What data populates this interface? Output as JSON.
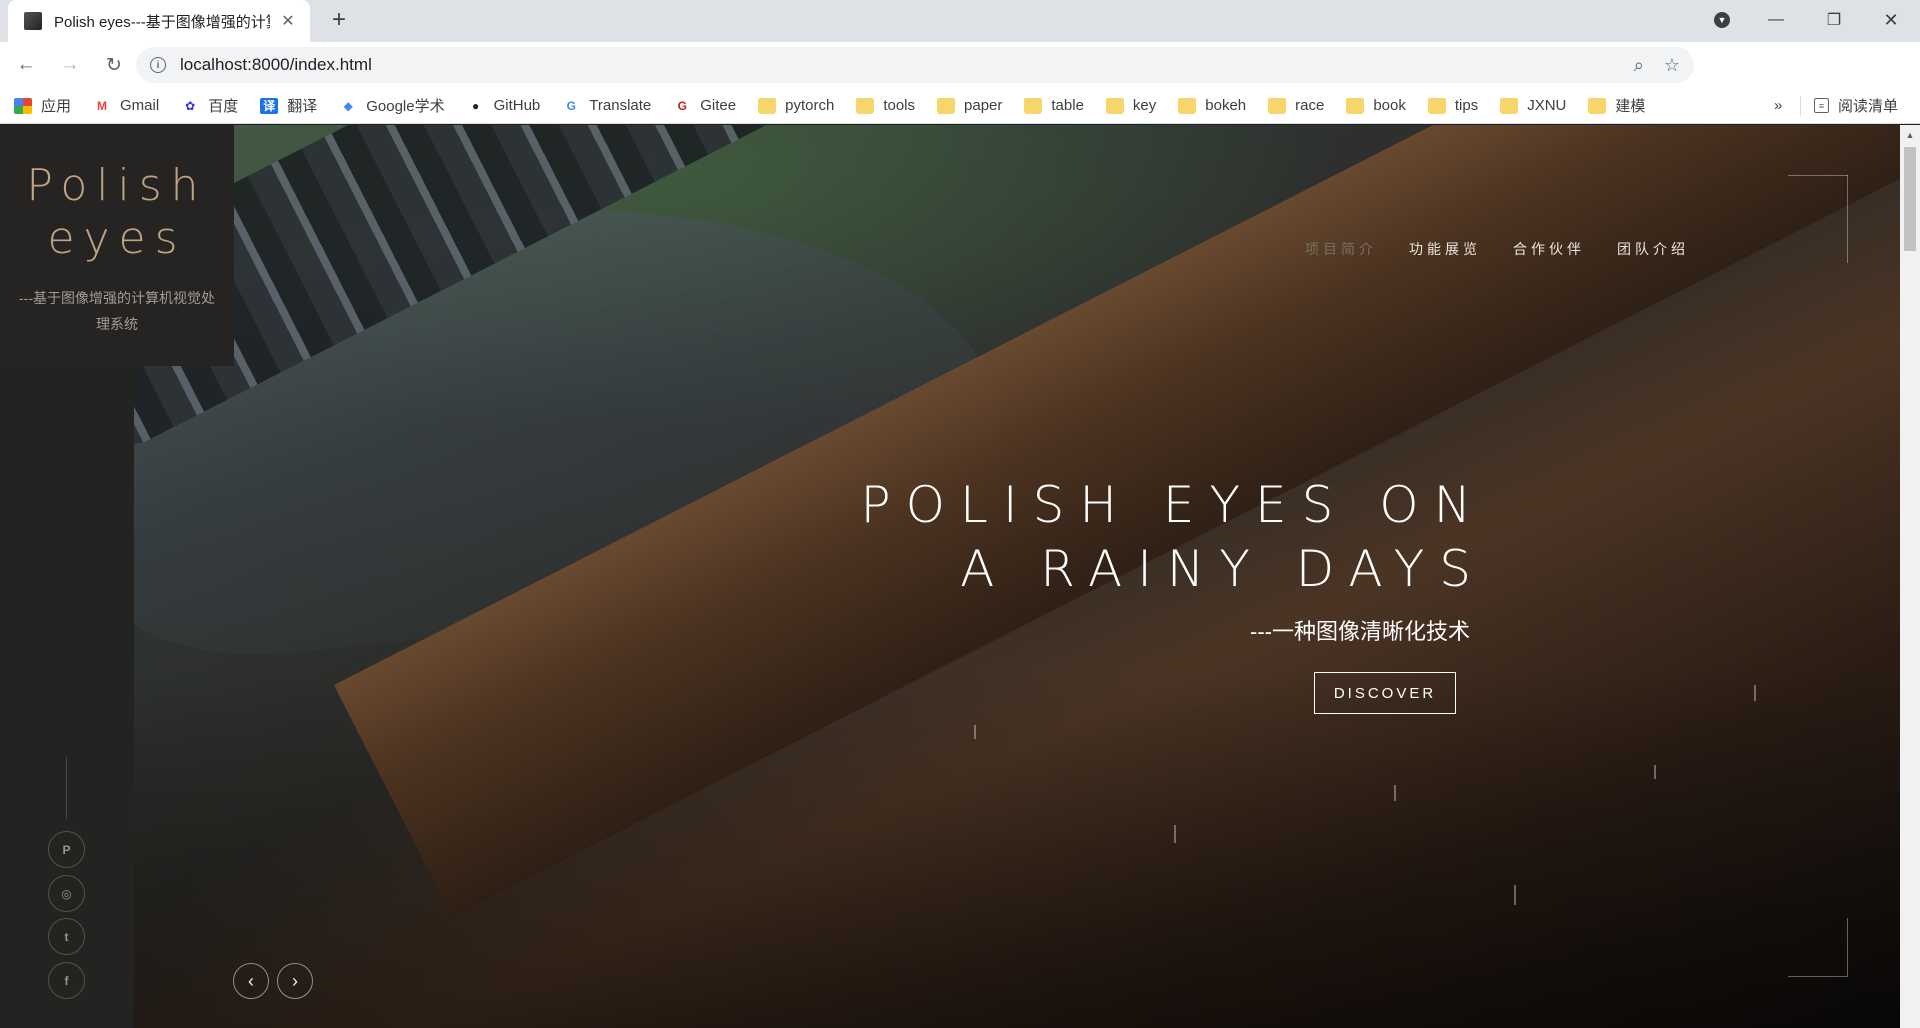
{
  "browser": {
    "tab_title": "Polish eyes---基于图像增强的计算机视觉处理系统",
    "url": "localhost:8000/index.html",
    "bookmarks": [
      {
        "label": "应用",
        "icon": "apps-grid-icon"
      },
      {
        "label": "Gmail",
        "icon": "gmail-icon"
      },
      {
        "label": "百度",
        "icon": "baidu-icon"
      },
      {
        "label": "翻译",
        "icon": "translate-icon"
      },
      {
        "label": "Google学术",
        "icon": "google-scholar-icon"
      },
      {
        "label": "GitHub",
        "icon": "github-icon"
      },
      {
        "label": "Translate",
        "icon": "google-translate-icon"
      },
      {
        "label": "Gitee",
        "icon": "gitee-icon"
      },
      {
        "label": "pytorch",
        "icon": "folder-icon"
      },
      {
        "label": "tools",
        "icon": "folder-icon"
      },
      {
        "label": "paper",
        "icon": "folder-icon"
      },
      {
        "label": "table",
        "icon": "folder-icon"
      },
      {
        "label": "key",
        "icon": "folder-icon"
      },
      {
        "label": "bokeh",
        "icon": "folder-icon"
      },
      {
        "label": "race",
        "icon": "folder-icon"
      },
      {
        "label": "book",
        "icon": "folder-icon"
      },
      {
        "label": "tips",
        "icon": "folder-icon"
      },
      {
        "label": "JXNU",
        "icon": "folder-icon"
      },
      {
        "label": "建模",
        "icon": "folder-icon"
      }
    ],
    "more_bookmarks": "»",
    "reading_list": "阅读清单"
  },
  "site": {
    "logo_line1": "Polish",
    "logo_line2": "eyes",
    "tagline": "---基于图像增强的计算机视觉处理系统",
    "nav": [
      {
        "label": "项目简介",
        "active": true
      },
      {
        "label": "功能展览",
        "active": false
      },
      {
        "label": "合作伙伴",
        "active": false
      },
      {
        "label": "团队介绍",
        "active": false
      }
    ],
    "headline_line1": "POLISH EYES ON",
    "headline_line2": "A RAINY DAYS",
    "subheadline": "---一种图像清晰化技术",
    "cta": "DISCOVER",
    "social": [
      {
        "icon": "pinterest-icon",
        "glyph": "P"
      },
      {
        "icon": "instagram-icon",
        "glyph": "◎"
      },
      {
        "icon": "twitter-icon",
        "glyph": "t"
      },
      {
        "icon": "facebook-icon",
        "glyph": "f"
      }
    ],
    "prev_glyph": "‹",
    "next_glyph": "›"
  }
}
